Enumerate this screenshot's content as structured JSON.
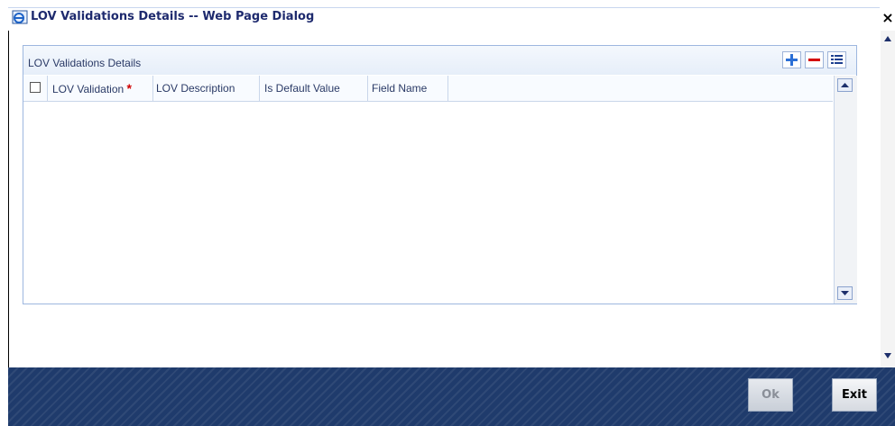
{
  "window": {
    "title": "LOV Validations Details -- Web Page Dialog",
    "close_label": "×"
  },
  "panel": {
    "title": "LOV Validations Details",
    "toolbar": {
      "add_icon": "plus-icon",
      "remove_icon": "minus-icon",
      "view_icon": "list-view-icon"
    }
  },
  "grid": {
    "columns": [
      {
        "label": "LOV Validation",
        "required": true,
        "required_mark": "*"
      },
      {
        "label": "LOV Description"
      },
      {
        "label": "Is Default Value"
      },
      {
        "label": "Field Name"
      }
    ],
    "rows": []
  },
  "footer": {
    "ok_label": "Ok",
    "exit_label": "Exit"
  },
  "colors": {
    "title_text": "#1e2a6e",
    "footer_bg": "#1f3b6c",
    "required_mark": "#d00000",
    "add_icon": "#2b6fd6",
    "remove_icon": "#d40000"
  }
}
